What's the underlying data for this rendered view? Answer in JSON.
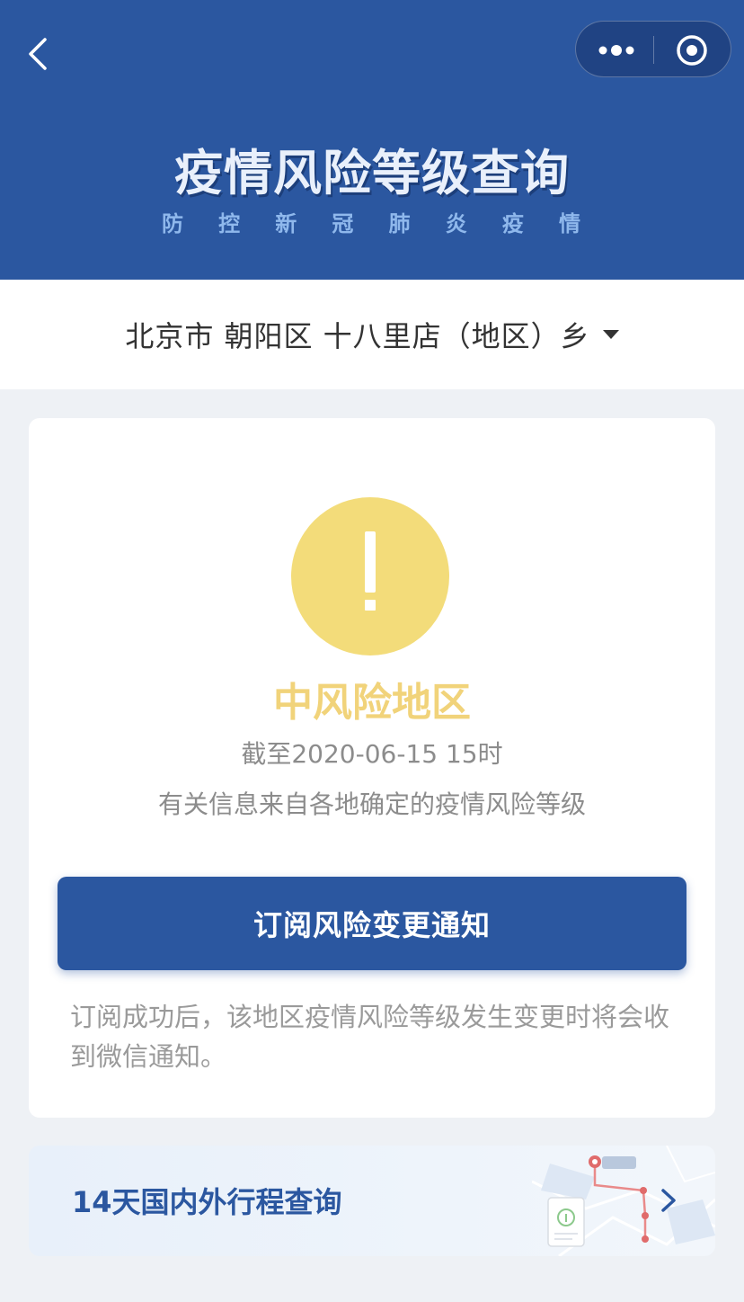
{
  "header": {
    "title": "疫情风险等级查询",
    "subtitle_chars": [
      "防",
      "控",
      "新",
      "冠",
      "肺",
      "炎",
      "疫",
      "情"
    ]
  },
  "location": {
    "text": "北京市 朝阳区 十八里店（地区）乡"
  },
  "risk_card": {
    "level": "中风险地区",
    "as_of": "截至2020-06-15 15时",
    "info_note": "有关信息来自各地确定的疫情风险等级",
    "subscribe_button": "订阅风险变更通知",
    "subscribe_note": "订阅成功后，该地区疫情风险等级发生变更时将会收到微信通知。"
  },
  "trip_card": {
    "label": "14天国内外行程查询"
  },
  "colors": {
    "brand_blue": "#2b57a0",
    "medium_risk_yellow": "#f3dc7a",
    "risk_text_yellow": "#f1d37a"
  },
  "icons": {
    "back": "chevron-left-icon",
    "more": "more-dots-icon",
    "close": "close-circle-icon",
    "warning": "exclamation-icon",
    "caret": "caret-down-icon",
    "trip_arrow": "chevron-right-icon"
  }
}
